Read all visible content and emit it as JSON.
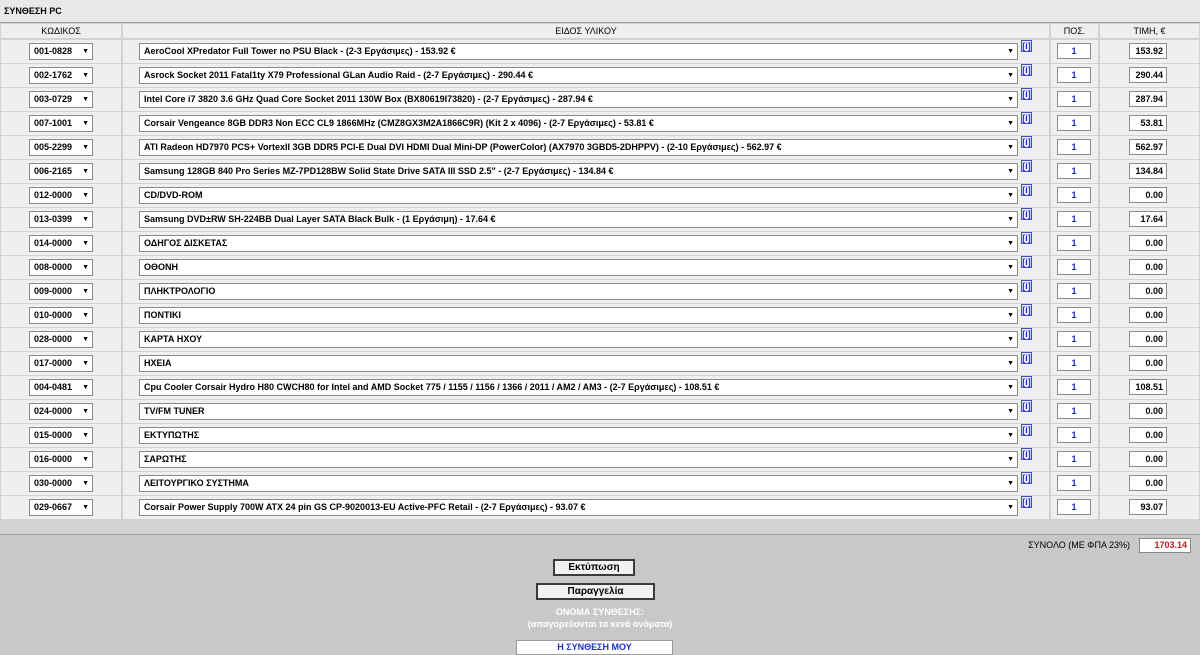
{
  "page_title": "ΣΥΝΘΕΣΗ PC",
  "columns": {
    "code": "ΚΩΔΙΚΟΣ",
    "item": "ΕΙΔΟΣ ΥΛΙΚΟΥ",
    "qty": "ΠΟΣ.",
    "price": "ΤΙΜΗ, €"
  },
  "info_label": "[i]",
  "rows": [
    {
      "code": "001-0828",
      "item": "AeroCool XPredator Full Tower no PSU Black - (2-3 Εργάσιμες) - 153.92 €",
      "qty": "1",
      "price": "153.92"
    },
    {
      "code": "002-1762",
      "item": "Asrock Socket 2011 Fatal1ty X79 Professional GLan Audio Raid - (2-7 Εργάσιμες) - 290.44 €",
      "qty": "1",
      "price": "290.44"
    },
    {
      "code": "003-0729",
      "item": "Intel Core i7 3820 3.6 GHz Quad Core Socket 2011 130W Box (BX80619I73820) - (2-7 Εργάσιμες) - 287.94 €",
      "qty": "1",
      "price": "287.94"
    },
    {
      "code": "007-1001",
      "item": "Corsair Vengeance 8GB DDR3 Non ECC CL9 1866MHz (CMZ8GX3M2A1866C9R) (Kit 2 x 4096) - (2-7 Εργάσιμες) - 53.81 €",
      "qty": "1",
      "price": "53.81"
    },
    {
      "code": "005-2299",
      "item": "ATI Radeon HD7970 PCS+ VortexII 3GB DDR5 PCI-E Dual DVI HDMI Dual Mini-DP (PowerColor) (AX7970 3GBD5-2DHPPV) - (2-10 Εργάσιμες) - 562.97 €",
      "qty": "1",
      "price": "562.97"
    },
    {
      "code": "006-2165",
      "item": "Samsung 128GB 840 Pro Series MZ-7PD128BW Solid State Drive SATA III SSD 2.5\" - (2-7 Εργάσιμες) - 134.84 €",
      "qty": "1",
      "price": "134.84"
    },
    {
      "code": "012-0000",
      "item": "CD/DVD-ROM",
      "qty": "1",
      "price": "0.00"
    },
    {
      "code": "013-0399",
      "item": "Samsung DVD±RW SH-224BB Dual Layer SATA Black Bulk - (1 Εργάσιμη) - 17.64 €",
      "qty": "1",
      "price": "17.64"
    },
    {
      "code": "014-0000",
      "item": "ΟΔΗΓΟΣ ΔΙΣΚΕΤΑΣ",
      "qty": "1",
      "price": "0.00"
    },
    {
      "code": "008-0000",
      "item": "ΟΘΟΝΗ",
      "qty": "1",
      "price": "0.00"
    },
    {
      "code": "009-0000",
      "item": "ΠΛΗΚΤΡΟΛΟΓΙΟ",
      "qty": "1",
      "price": "0.00"
    },
    {
      "code": "010-0000",
      "item": "ΠΟΝΤΙΚΙ",
      "qty": "1",
      "price": "0.00"
    },
    {
      "code": "028-0000",
      "item": "ΚΑΡΤΑ ΗΧΟΥ",
      "qty": "1",
      "price": "0.00"
    },
    {
      "code": "017-0000",
      "item": "ΗΧΕΙΑ",
      "qty": "1",
      "price": "0.00"
    },
    {
      "code": "004-0481",
      "item": "Cpu Cooler Corsair Hydro H80 CWCH80 for Intel and AMD Socket 775 / 1155 / 1156 / 1366 / 2011 / AM2 / AM3 - (2-7 Εργάσιμες) - 108.51 €",
      "qty": "1",
      "price": "108.51"
    },
    {
      "code": "024-0000",
      "item": "TV/FM TUNER",
      "qty": "1",
      "price": "0.00"
    },
    {
      "code": "015-0000",
      "item": "ΕΚΤΥΠΩΤΗΣ",
      "qty": "1",
      "price": "0.00"
    },
    {
      "code": "016-0000",
      "item": "ΣΑΡΩΤΗΣ",
      "qty": "1",
      "price": "0.00"
    },
    {
      "code": "030-0000",
      "item": "ΛΕΙΤΟΥΡΓΙΚΟ ΣΥΣΤΗΜΑ",
      "qty": "1",
      "price": "0.00"
    },
    {
      "code": "029-0667",
      "item": "Corsair Power Supply 700W ATX 24 pin GS CP-9020013-EU Active-PFC Retail - (2-7 Εργάσιμες) - 93.07 €",
      "qty": "1",
      "price": "93.07"
    }
  ],
  "total": {
    "label": "ΣΥΝΟΛΟ (ΜΕ ΦΠΑ 23%)",
    "value": "1703.14"
  },
  "buttons": {
    "print": "Εκτύπωση",
    "order": "Παραγγελία"
  },
  "name_section": {
    "label": "ΟΝΟΜΑ ΣΥΝΘΕΣΗΣ:",
    "hint": "(απαγορεύονται τα κενά ονόματα)",
    "value": "Η ΣΥΝΘΕΣΗ ΜΟΥ"
  },
  "colors": {
    "total_value": "#c81e1e",
    "qty_text": "#1a32c8",
    "info_icon": "#1d32d0"
  }
}
